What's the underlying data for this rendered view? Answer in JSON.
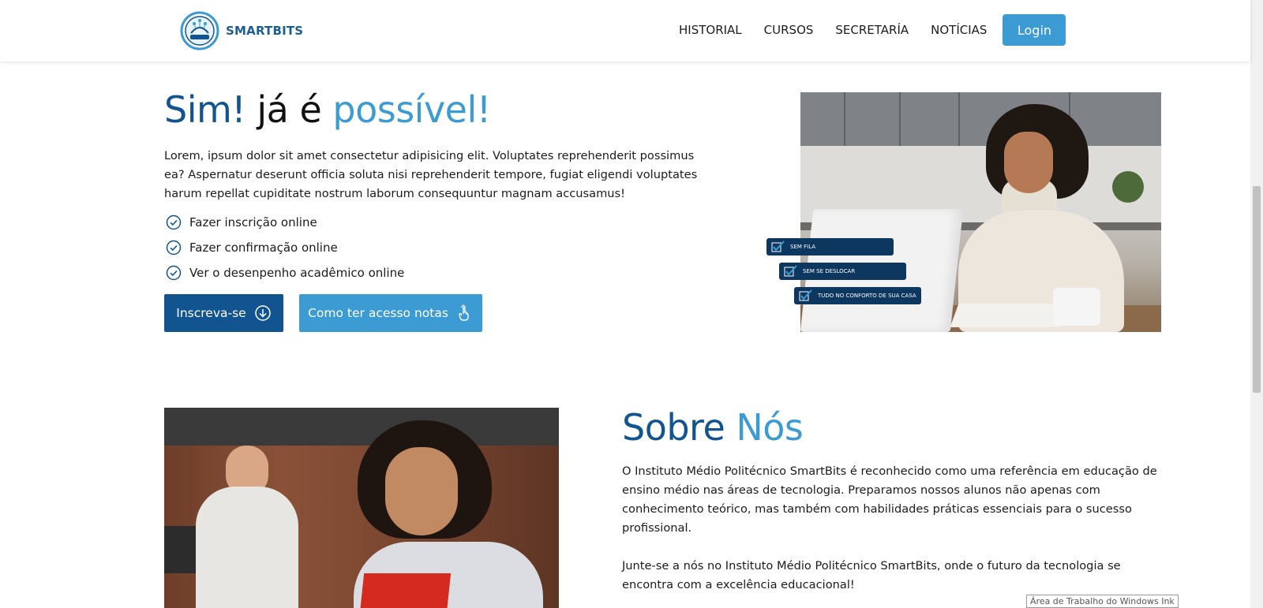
{
  "header": {
    "logo_text": "SMARTBITS",
    "nav": [
      "HISTORIAL",
      "CURSOS",
      "SECRETARÍA",
      "NOTÍCIAS"
    ],
    "login_label": "Login"
  },
  "hero": {
    "title_part1": "Sim!",
    "title_part2": "já é",
    "title_part3": "possível!",
    "text": "Lorem, ipsum dolor sit amet consectetur adipisicing elit. Voluptates reprehenderit possimus ea? Aspernatur deserunt officia soluta nisi reprehenderit tempore, fugiat eligendi voluptates harum repellat cupiditate nostrum laborum consequuntur magnam accusamus!",
    "checks": [
      "Fazer inscrição online",
      "Fazer confirmação online",
      "Ver o desenpenho acadêmico online"
    ],
    "primary_button": "Inscreva-se",
    "secondary_button": "Como ter acesso notas",
    "badges": [
      "SEM FILA",
      "SEM SE DESLOCAR",
      "TUDO NO CONFORTO DE SUA CASA"
    ]
  },
  "about": {
    "title_part1": "Sobre",
    "title_part2": "Nós",
    "paragraph1": "O Instituto Médio Politécnico SmartBits é reconhecido como uma referência em educação de ensino médio nas áreas de tecnologia. Preparamos nossos alunos não apenas com conhecimento teórico, mas também com habilidades práticas essenciais para o sucesso profissional.",
    "paragraph2": "Junte-se a nós no Instituto Médio Politécnico SmartBits, onde o futuro da tecnologia se encontra com a excelência educacional!"
  },
  "tooltip": "Área de Trabalho do Windows Ink",
  "colors": {
    "brand_dark": "#12548f",
    "brand_light": "#3b9bd2",
    "badge_bg": "#0e3760"
  }
}
